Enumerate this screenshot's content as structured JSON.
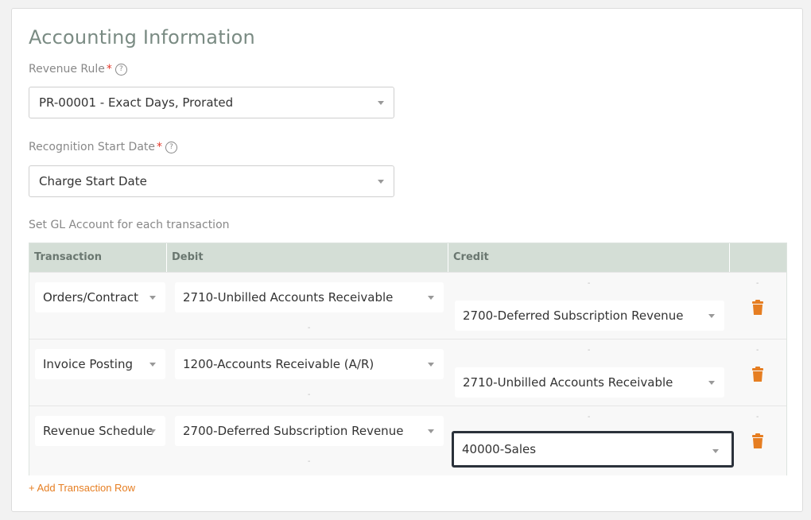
{
  "section_title": "Accounting Information",
  "revenue_rule": {
    "label": "Revenue Rule",
    "required_mark": "*",
    "help": "?",
    "value": "PR-00001 - Exact Days, Prorated"
  },
  "recognition_start": {
    "label": "Recognition Start Date",
    "required_mark": "*",
    "help": "?",
    "value": "Charge Start Date"
  },
  "gl_label": "Set GL Account for each transaction",
  "table": {
    "headers": {
      "transaction": "Transaction",
      "debit": "Debit",
      "credit": "Credit"
    },
    "rows": [
      {
        "transaction": "Orders/Contract",
        "debit": "2710-Unbilled Accounts Receivable",
        "credit": "2700-Deferred Subscription Revenue"
      },
      {
        "transaction": "Invoice Posting",
        "debit": "1200-Accounts Receivable (A/R)",
        "credit": "2710-Unbilled Accounts Receivable"
      },
      {
        "transaction": "Revenue Schedule",
        "debit": "2700-Deferred Subscription Revenue",
        "credit": "40000-Sales"
      }
    ],
    "placeholder_dash": "-"
  },
  "add_row_label": "+ Add Transaction Row",
  "colors": {
    "accent": "#e67e22",
    "header_bg": "#d4ded6",
    "required": "#e4392b",
    "title": "#7a8b83"
  }
}
